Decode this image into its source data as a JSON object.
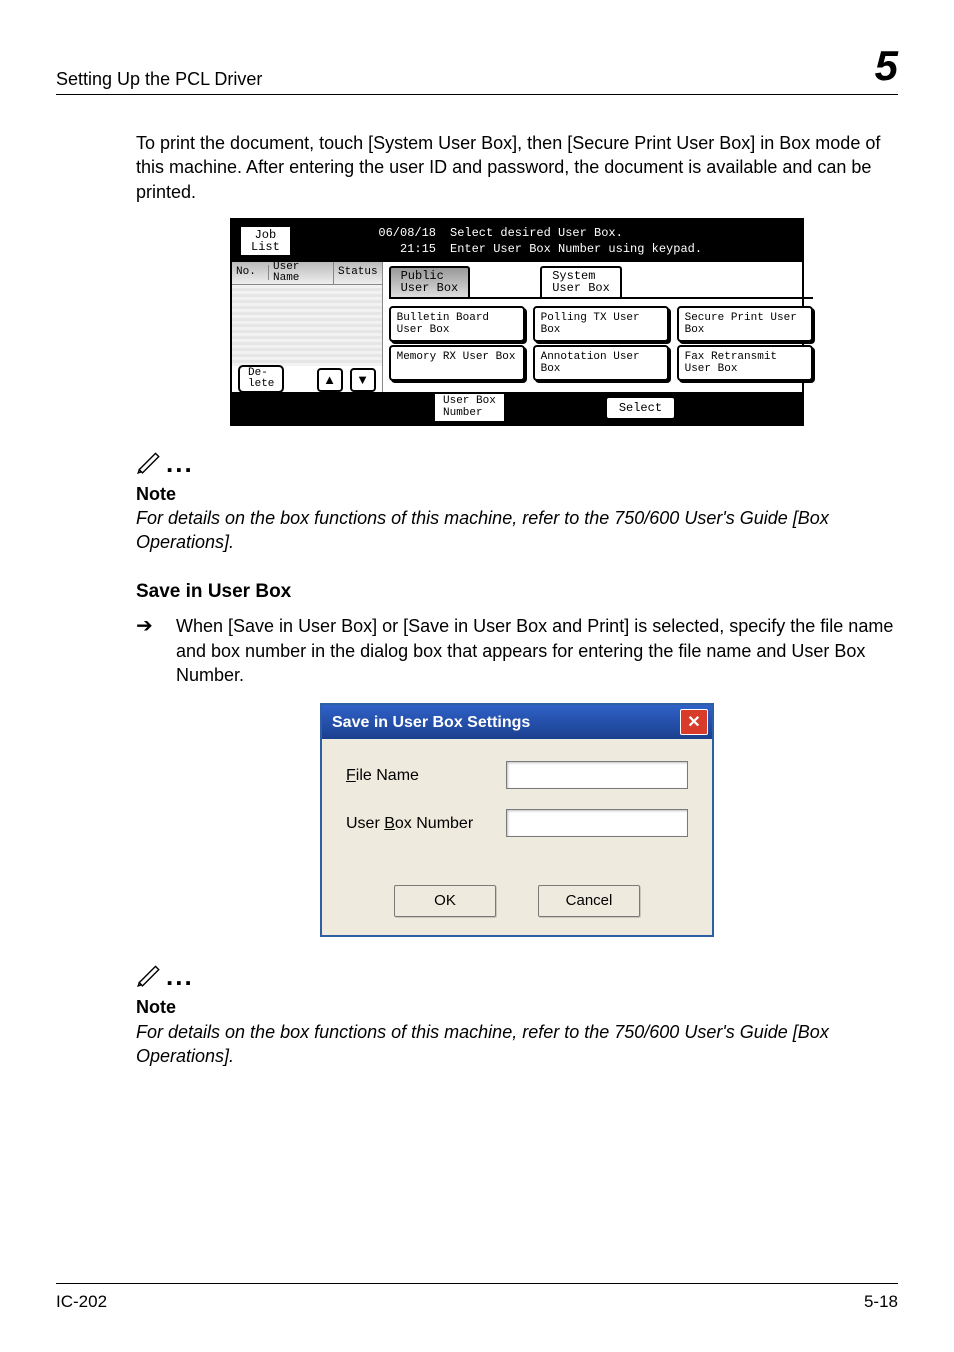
{
  "header": {
    "left": "Setting Up the PCL Driver",
    "right": "5"
  },
  "intro": "To print the document, touch [System User Box], then [Secure Print User Box] in Box mode of this machine. After entering the user ID and password, the document is available and can be printed.",
  "mfp": {
    "job_list": "Job\nList",
    "datetime": "06/08/18\n21:15",
    "msg1": "Select desired User Box.",
    "msg2": "Enter User Box Number using keypad.",
    "col_no": "No.",
    "col_user": "User\nName",
    "col_status": "Status",
    "delete": "De-\nlete",
    "tab_public": "Public\nUser Box",
    "tab_system": "System\nUser Box",
    "boxes": [
      [
        "Bulletin Board User Box",
        "Polling TX User Box",
        "Secure Print User Box"
      ],
      [
        "Memory RX User Box",
        "Annotation User Box",
        "Fax Retransmit User Box"
      ]
    ],
    "ubnum": "User Box\nNumber",
    "select": "Select"
  },
  "note1": {
    "title": "Note",
    "body": "For details on the box functions of this machine, refer to the 750/600 User's Guide [Box Operations]."
  },
  "subhead": "Save in User Box",
  "bullet1": "When [Save in User Box] or [Save in User Box and Print] is selected, specify the file name and box number in the dialog box that appears for entering the file name and User Box Number.",
  "dialog": {
    "title": "Save in User Box Settings",
    "file_pre": "F",
    "file_u": "",
    "file_post": "ile Name",
    "box_pre": "User ",
    "box_u": "B",
    "box_post": "ox Number",
    "ok": "OK",
    "cancel": "Cancel"
  },
  "note2": {
    "title": "Note",
    "body": "For details on the box functions of this machine, refer to the 750/600 User's Guide [Box Operations]."
  },
  "footer": {
    "left": "IC-202",
    "right": "5-18"
  }
}
